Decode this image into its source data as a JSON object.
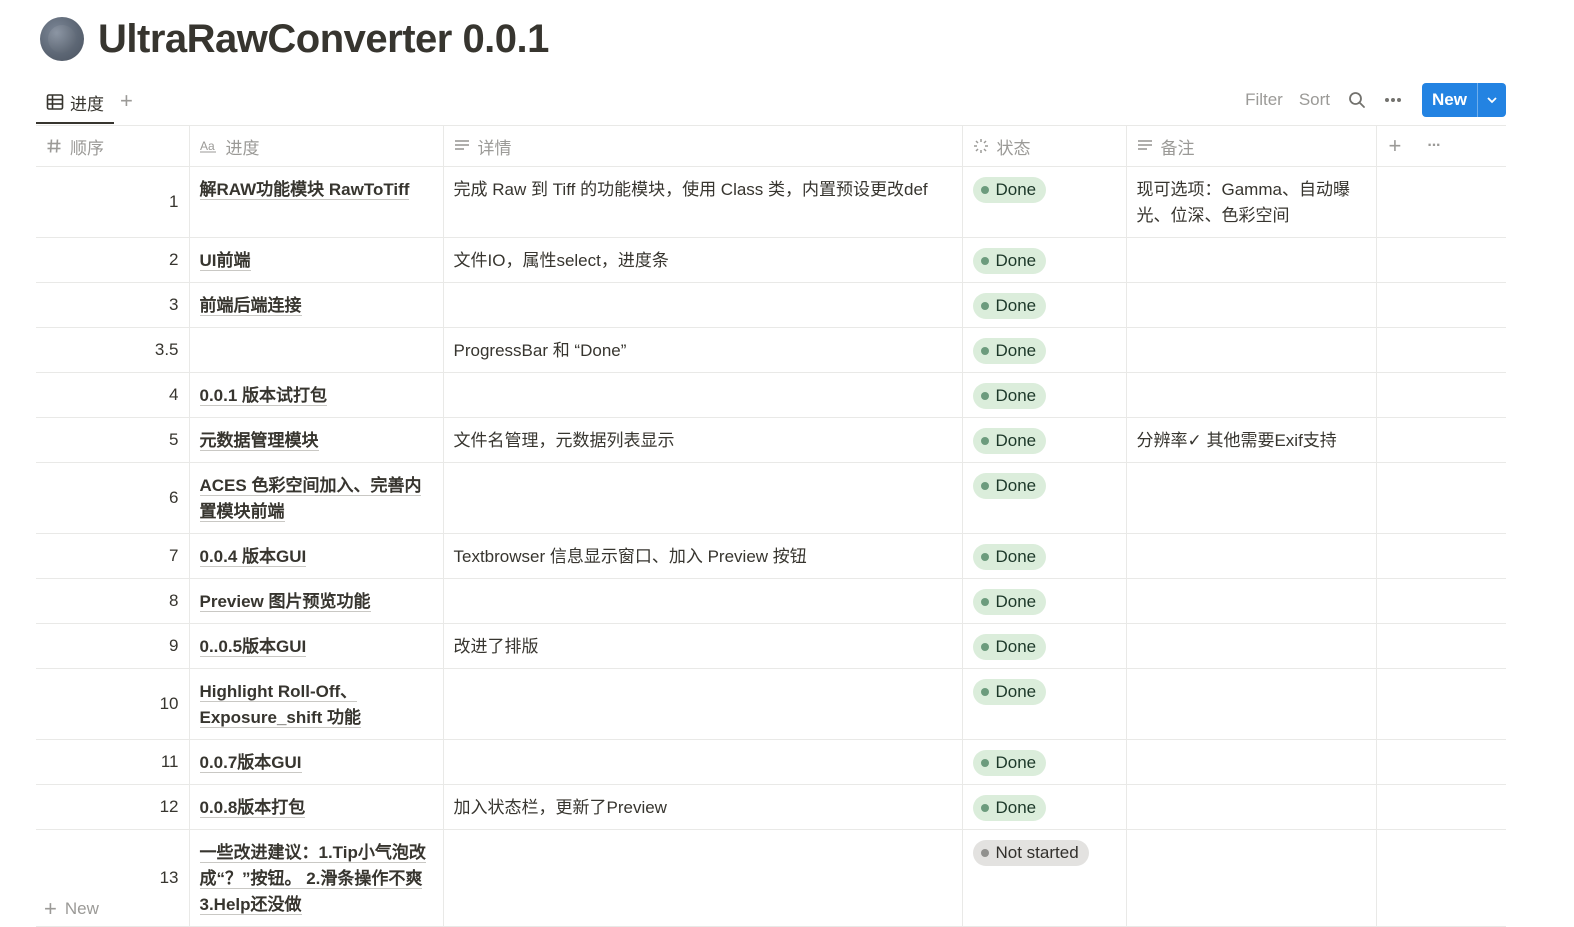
{
  "page": {
    "title": "UltraRawConverter 0.0.1"
  },
  "view": {
    "tab_label": "进度",
    "add_view": "+"
  },
  "toolbar": {
    "filter": "Filter",
    "sort": "Sort",
    "new": "New"
  },
  "columns": {
    "order": "顺序",
    "progress": "进度",
    "detail": "详情",
    "status": "状态",
    "note": "备注",
    "add": "+",
    "more": "···"
  },
  "rows": [
    {
      "num": "1",
      "progress": "解RAW功能模块 RawToTiff",
      "detail": "完成 Raw 到 Tiff 的功能模块，使用 Class 类，内置预设更改def",
      "status": "Done",
      "note": "现可选项：Gamma、自动曝光、位深、色彩空间"
    },
    {
      "num": "2",
      "progress": "UI前端",
      "detail": "文件IO，属性select，进度条",
      "status": "Done",
      "note": ""
    },
    {
      "num": "3",
      "progress": "前端后端连接",
      "detail": "",
      "status": "Done",
      "note": ""
    },
    {
      "num": "3.5",
      "progress": "",
      "detail": "ProgressBar 和 “Done”",
      "status": "Done",
      "note": ""
    },
    {
      "num": "4",
      "progress": "0.0.1 版本试打包",
      "detail": "",
      "status": "Done",
      "note": ""
    },
    {
      "num": "5",
      "progress": "元数据管理模块",
      "detail": "文件名管理，元数据列表显示",
      "status": "Done",
      "note": "分辨率✓  其他需要Exif支持"
    },
    {
      "num": "6",
      "progress": "ACES 色彩空间加入、完善内置模块前端",
      "detail": "",
      "status": "Done",
      "note": ""
    },
    {
      "num": "7",
      "progress": "0.0.4 版本GUI",
      "detail": "Textbrowser 信息显示窗口、加入 Preview 按钮",
      "status": "Done",
      "note": ""
    },
    {
      "num": "8",
      "progress": "Preview 图片预览功能",
      "detail": "",
      "status": "Done",
      "note": ""
    },
    {
      "num": "9",
      "progress": "0..0.5版本GUI",
      "detail": "改进了排版",
      "status": "Done",
      "note": ""
    },
    {
      "num": "10",
      "progress": "Highlight Roll-Off、Exposure_shift 功能",
      "detail": "",
      "status": "Done",
      "note": ""
    },
    {
      "num": "11",
      "progress": "0.0.7版本GUI",
      "detail": "",
      "status": "Done",
      "note": ""
    },
    {
      "num": "12",
      "progress": "0.0.8版本打包",
      "detail": "加入状态栏，更新了Preview",
      "status": "Done",
      "note": ""
    },
    {
      "num": "13",
      "progress": "一些改进建议：1.Tip小气泡改成“？”按钮。 2.滑条操作不爽 3.Help还没做",
      "detail": "",
      "status": "Not started",
      "note": ""
    }
  ],
  "footer": {
    "new_row": "New"
  },
  "colors": {
    "accent": "#2383e2",
    "done_bg": "#dbeddb",
    "done_dot": "#6c9b7d",
    "not_bg": "#e3e2e0",
    "not_dot": "#91918e"
  }
}
